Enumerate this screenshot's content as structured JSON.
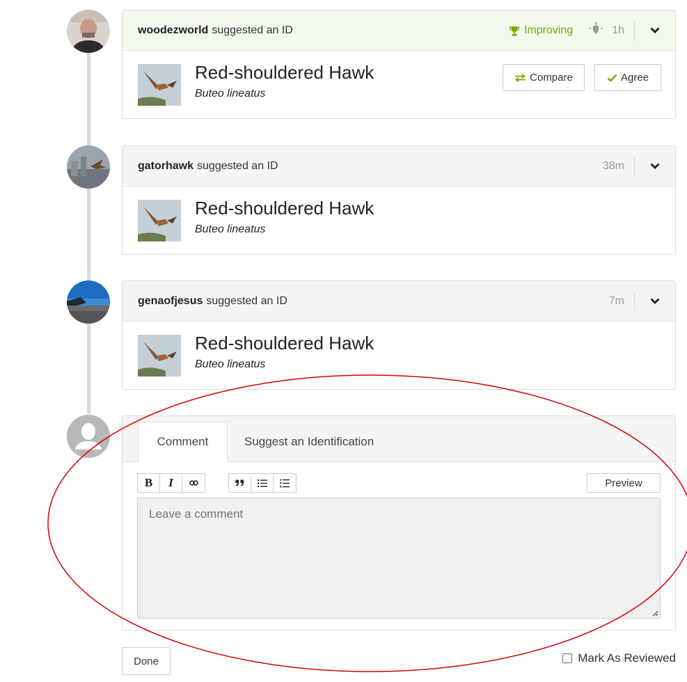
{
  "identifications": [
    {
      "user": "woodezworld",
      "action": "suggested an ID",
      "badge": "Improving",
      "time": "1h",
      "common_name": "Red-shouldered Hawk",
      "scientific_name": "Buteo lineatus",
      "compare_label": "Compare",
      "agree_label": "Agree"
    },
    {
      "user": "gatorhawk",
      "action": "suggested an ID",
      "time": "38m",
      "common_name": "Red-shouldered Hawk",
      "scientific_name": "Buteo lineatus"
    },
    {
      "user": "genaofjesus",
      "action": "suggested an ID",
      "time": "7m",
      "common_name": "Red-shouldered Hawk",
      "scientific_name": "Buteo lineatus"
    }
  ],
  "composer": {
    "tabs": [
      "Comment",
      "Suggest an Identification"
    ],
    "active_tab": "Comment",
    "toolbar": {
      "bold": "B",
      "italic": "I",
      "link": "link-icon",
      "quote": "quote-icon",
      "bullet_list": "bullet-list-icon",
      "numbered_list": "numbered-list-icon"
    },
    "preview_label": "Preview",
    "placeholder": "Leave a comment"
  },
  "footer": {
    "done_label": "Done",
    "mark_reviewed_label": "Mark As Reviewed",
    "mark_reviewed_checked": false
  },
  "colors": {
    "improving_green": "#74ac00",
    "annotation_red": "#d40000"
  }
}
